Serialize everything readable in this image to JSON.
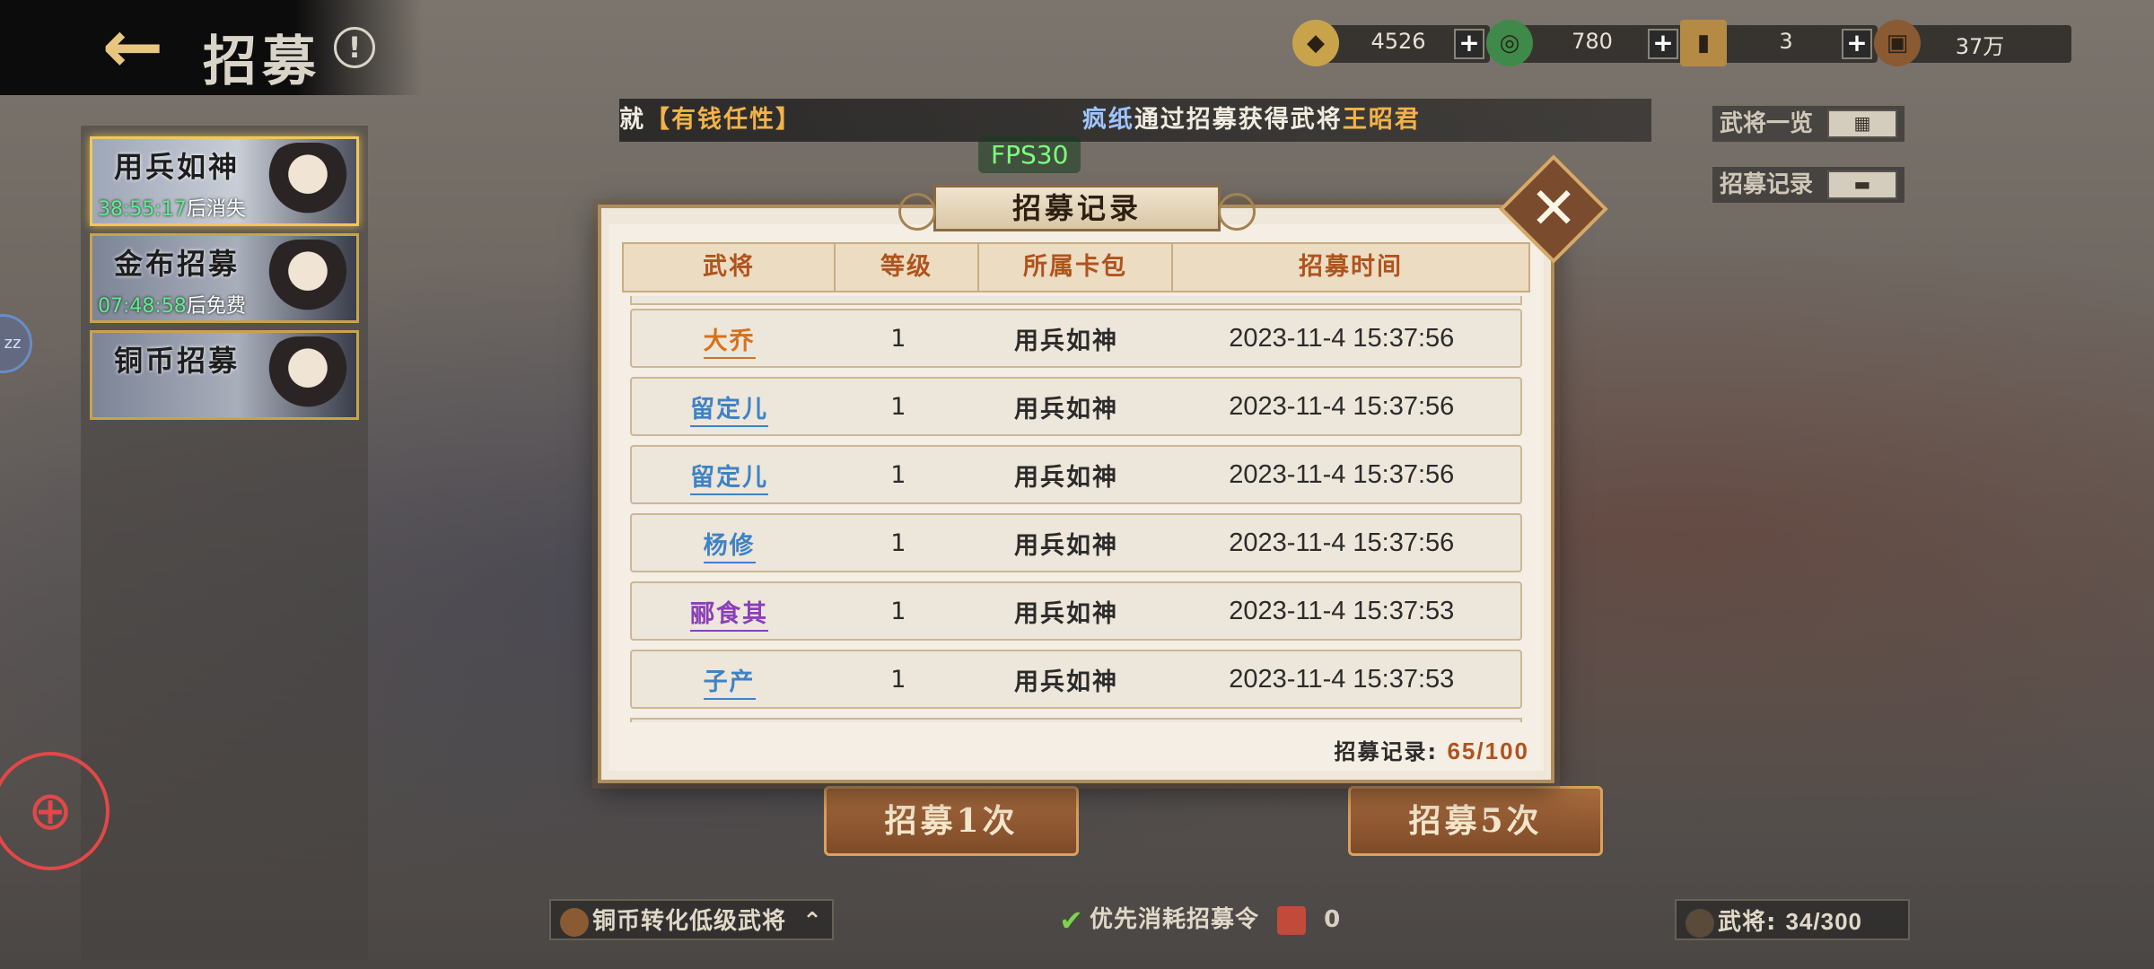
{
  "header": {
    "title": "招募",
    "currencies": [
      {
        "icon": "gold-token-icon",
        "value": "4526"
      },
      {
        "icon": "jade-coin-icon",
        "value": "780"
      },
      {
        "icon": "tower-token-icon",
        "value": "3"
      },
      {
        "icon": "copper-coin-icon",
        "value": "37万"
      }
    ]
  },
  "marquee": {
    "prefix": "就",
    "achievement": "【有钱任性】",
    "player": "疯纸",
    "mid": "通过招募获得武将",
    "general": "王昭君"
  },
  "fps": "FPS30",
  "side_buttons": {
    "generals_list": "武将一览",
    "recruit_log": "招募记录"
  },
  "banners": [
    {
      "name": "用兵如神",
      "timer": "38:55:17",
      "suffix": "后消失"
    },
    {
      "name": "金布招募",
      "timer": "07:48:58",
      "suffix": "后免费"
    },
    {
      "name": "铜币招募"
    }
  ],
  "float_badge": "zz",
  "modal": {
    "title": "招募记录",
    "columns": [
      "武将",
      "等级",
      "所属卡包",
      "招募时间"
    ],
    "rows": [
      {
        "name": "大乔",
        "color": "#d7711b",
        "level": "1",
        "pack": "用兵如神",
        "time": "2023-11-4 15:37:56"
      },
      {
        "name": "留定儿",
        "color": "#3f82c6",
        "level": "1",
        "pack": "用兵如神",
        "time": "2023-11-4 15:37:56"
      },
      {
        "name": "留定儿",
        "color": "#3f82c6",
        "level": "1",
        "pack": "用兵如神",
        "time": "2023-11-4 15:37:56"
      },
      {
        "name": "杨修",
        "color": "#3f82c6",
        "level": "1",
        "pack": "用兵如神",
        "time": "2023-11-4 15:37:56"
      },
      {
        "name": "郦食其",
        "color": "#8b3fb8",
        "level": "1",
        "pack": "用兵如神",
        "time": "2023-11-4 15:37:53"
      },
      {
        "name": "子产",
        "color": "#3f82c6",
        "level": "1",
        "pack": "用兵如神",
        "time": "2023-11-4 15:37:53"
      }
    ],
    "count_label": "招募记录:",
    "count_value": "65/100"
  },
  "actions": {
    "recruit_once": "招募1次",
    "recruit_five": "招募5次"
  },
  "bottom": {
    "convert_label": "铜币转化低级武将",
    "priority_label": "优先消耗招募令",
    "token_count": "0",
    "generals_label": "武将:",
    "generals_count": "34/300"
  },
  "colors": {
    "accent_orange": "#b0531e",
    "gold_border": "#c9a34c",
    "timer_green": "#5df08a",
    "fps_green": "#7dff7d",
    "gamepad_red": "#e24848"
  }
}
